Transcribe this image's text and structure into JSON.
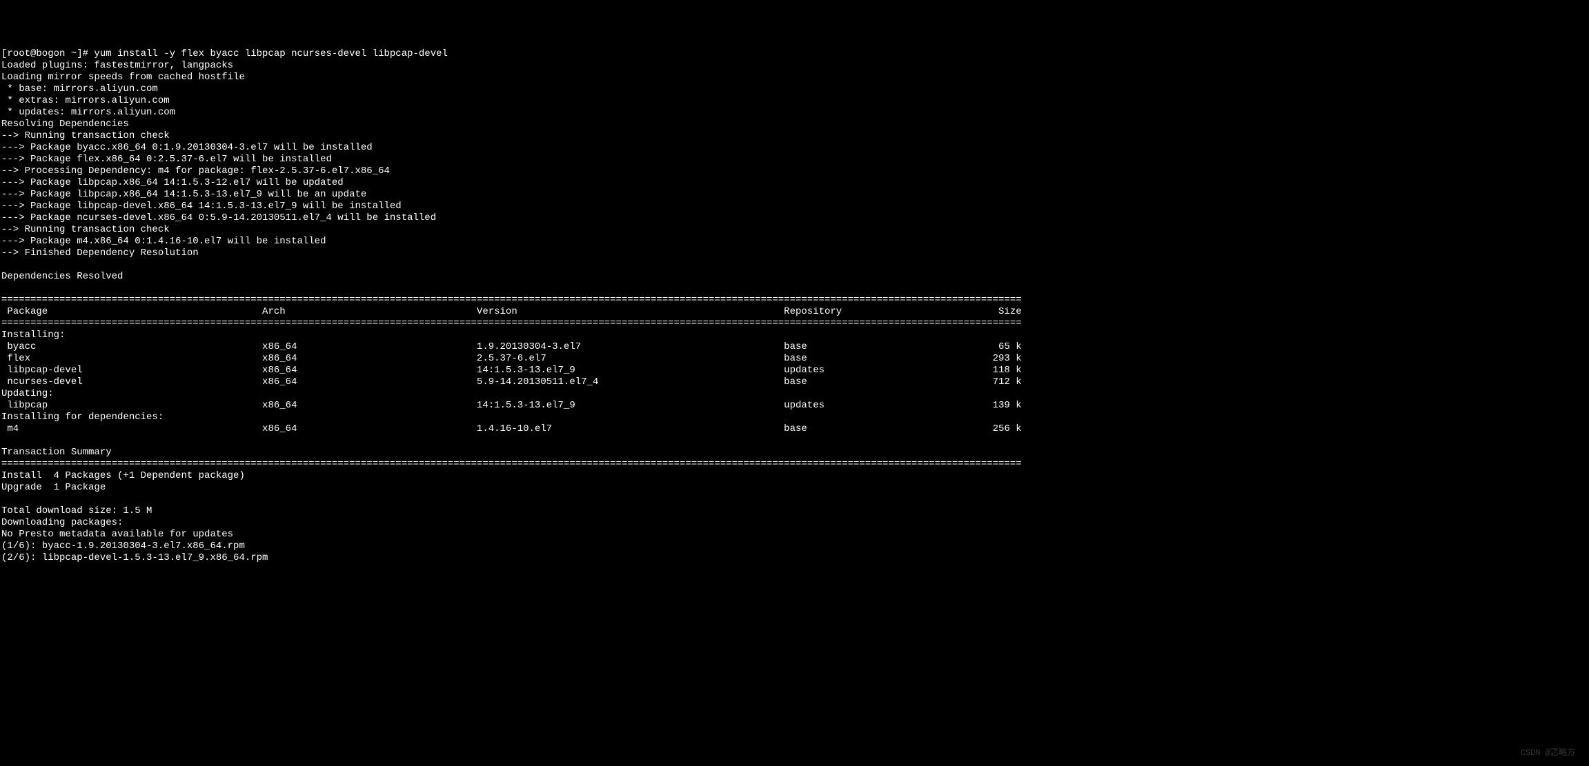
{
  "prompt": "[root@bogon ~]# yum install -y flex byacc libpcap ncurses-devel libpcap-devel",
  "loading": [
    "Loaded plugins: fastestmirror, langpacks",
    "Loading mirror speeds from cached hostfile",
    " * base: mirrors.aliyun.com",
    " * extras: mirrors.aliyun.com",
    " * updates: mirrors.aliyun.com"
  ],
  "resolving_header": "Resolving Dependencies",
  "resolving": [
    "--> Running transaction check",
    "---> Package byacc.x86_64 0:1.9.20130304-3.el7 will be installed",
    "---> Package flex.x86_64 0:2.5.37-6.el7 will be installed",
    "--> Processing Dependency: m4 for package: flex-2.5.37-6.el7.x86_64",
    "---> Package libpcap.x86_64 14:1.5.3-12.el7 will be updated",
    "---> Package libpcap.x86_64 14:1.5.3-13.el7_9 will be an update",
    "---> Package libpcap-devel.x86_64 14:1.5.3-13.el7_9 will be installed",
    "---> Package ncurses-devel.x86_64 0:5.9-14.20130511.el7_4 will be installed",
    "--> Running transaction check",
    "---> Package m4.x86_64 0:1.4.16-10.el7 will be installed",
    "--> Finished Dependency Resolution"
  ],
  "deps_resolved": "Dependencies Resolved",
  "separator": "================================================================================================================================================================================",
  "table_header": {
    "package": "Package",
    "arch": "Arch",
    "version": "Version",
    "repository": "Repository",
    "size": "Size"
  },
  "installing_label": "Installing:",
  "installing": [
    {
      "package": "byacc",
      "arch": "x86_64",
      "version": "1.9.20130304-3.el7",
      "repository": "base",
      "size": "65 k"
    },
    {
      "package": "flex",
      "arch": "x86_64",
      "version": "2.5.37-6.el7",
      "repository": "base",
      "size": "293 k"
    },
    {
      "package": "libpcap-devel",
      "arch": "x86_64",
      "version": "14:1.5.3-13.el7_9",
      "repository": "updates",
      "size": "118 k"
    },
    {
      "package": "ncurses-devel",
      "arch": "x86_64",
      "version": "5.9-14.20130511.el7_4",
      "repository": "base",
      "size": "712 k"
    }
  ],
  "updating_label": "Updating:",
  "updating": [
    {
      "package": "libpcap",
      "arch": "x86_64",
      "version": "14:1.5.3-13.el7_9",
      "repository": "updates",
      "size": "139 k"
    }
  ],
  "installing_deps_label": "Installing for dependencies:",
  "installing_deps": [
    {
      "package": "m4",
      "arch": "x86_64",
      "version": "1.4.16-10.el7",
      "repository": "base",
      "size": "256 k"
    }
  ],
  "transaction_summary": "Transaction Summary",
  "install_summary": "Install  4 Packages (+1 Dependent package)",
  "upgrade_summary": "Upgrade  1 Package",
  "download_size": "Total download size: 1.5 M",
  "downloading": "Downloading packages:",
  "no_presto": "No Presto metadata available for updates",
  "download_lines": [
    "(1/6): byacc-1.9.20130304-3.el7.x86_64.rpm",
    "(2/6): libpcap-devel-1.5.3-13.el7_9.x86_64.rpm"
  ],
  "watermark": "CSDN @忑略方"
}
